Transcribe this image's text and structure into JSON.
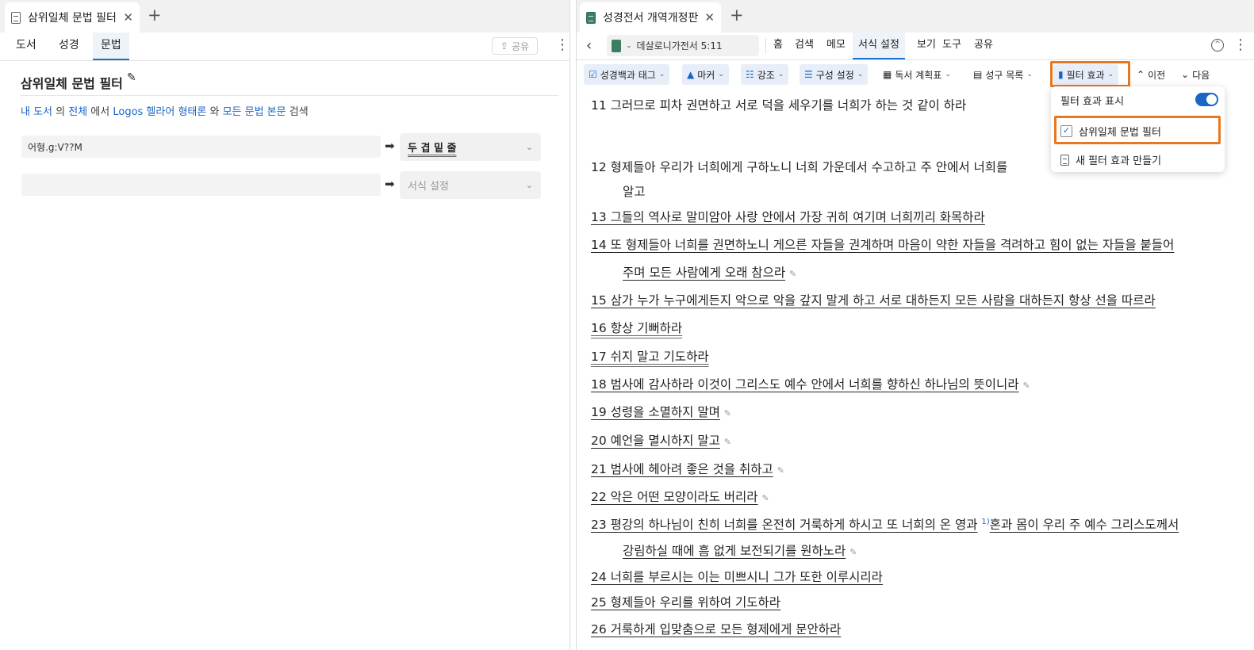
{
  "left": {
    "tab_title": "삼위일체 문법 필터",
    "subtabs": [
      "도서",
      "성경",
      "문법"
    ],
    "share": "공유",
    "title": "삼위일체 문법 필터",
    "desc": {
      "a": "내 도서",
      "b": " 의 ",
      "c": "전체",
      "d": " 에서 ",
      "e": "Logos 헬라어 형태론",
      "f": " 와 ",
      "g": "모든 문법 본문",
      "h": " 검색"
    },
    "rows": [
      {
        "query": "어형.g:V??M",
        "format": "두 겹 밑 줄"
      },
      {
        "query": "",
        "format": "서식 설정"
      }
    ]
  },
  "right": {
    "tab_title": "성경전서 개역개정판",
    "reference": "데살로니가전서 5:11",
    "nav": [
      "홈",
      "검색",
      "메모",
      "서식 설정",
      "보기",
      "도구",
      "공유"
    ],
    "toolbar": [
      "성경백과 태그",
      "마커",
      "강조",
      "구성 설정",
      "독서 계획표",
      "성구 목록",
      "필터 효과",
      "이전",
      "다음"
    ],
    "dropdown": {
      "show": "필터 효과 표시",
      "filter": "삼위일체 문법 필터",
      "new": "새 필터 효과 만들기"
    },
    "verses": {
      "v11": "11 그러므로 피차 권면하고 서로 덕을 세우기를 너희가 하는 것 같이 하라",
      "v12a": "12 형제들아 우리가 너희에게 구하노니 너희 가운데서 수고하고 주 안에서 너희를",
      "v12b": "알고",
      "v13": "13 그들의 역사로 말미암아 사랑 안에서 가장 귀히 여기며 너희끼리 화목하라",
      "v14a": "14 또 형제들아 너희를 권면하노니 게으른 자들을 권계하며 마음이 약한 자들을 격려하고 힘이 없는 자들을 붙들어",
      "v14b": "주며 모든 사람에게 오래 참으라",
      "v15": "15 삼가 누가 누구에게든지 악으로 악을 갚지 말게 하고 서로 대하든지 모든 사람을 대하든지 항상 선을 따르라",
      "v16": "16 항상 기뻐하라",
      "v17": "17 쉬지 말고 기도하라",
      "v18": "18 범사에 감사하라 이것이 그리스도 예수 안에서 너희를 향하신 하나님의 뜻이니라",
      "v19": "19 성령을 소멸하지 말며",
      "v20": "20 예언을 멸시하지 말고",
      "v21": "21 범사에 헤아려 좋은 것을 취하고",
      "v22": "22 악은 어떤 모양이라도 버리라",
      "v23a": "23 평강의 하나님이 친히 너희를 온전히 거룩하게 하시고 또 너희의 온 영과",
      "v23fn": "1)",
      "v23c": "혼과 몸이 우리 주 예수 그리스도께서",
      "v23b": "강림하실 때에 흠 없게 보전되기를 원하노라",
      "v24": "24 너희를 부르시는 이는 미쁘시니 그가 또한 이루시리라",
      "v25": "25 형제들아 우리를 위하여 기도하라",
      "v26": "26 거룩하게 입맞춤으로 모든 형제에게 문안하라"
    }
  }
}
